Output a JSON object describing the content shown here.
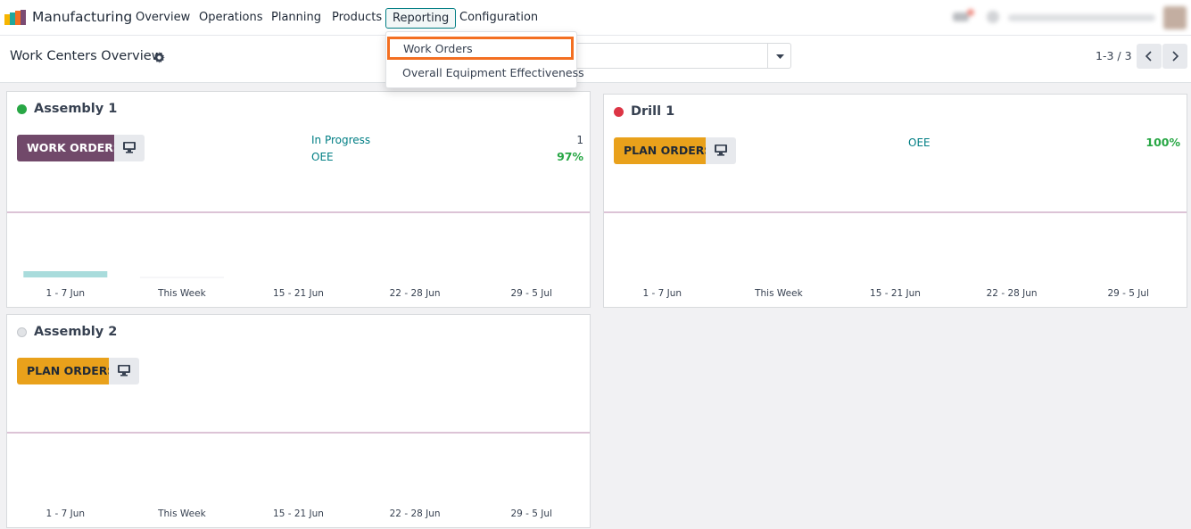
{
  "app": {
    "name": "Manufacturing"
  },
  "menu": {
    "overview": "Overview",
    "operations": "Operations",
    "planning": "Planning",
    "products": "Products",
    "reporting": "Reporting",
    "configuration": "Configuration"
  },
  "reporting_dropdown": {
    "work_orders": "Work Orders",
    "oee": "Overall Equipment Effectiveness"
  },
  "control_panel": {
    "title": "Work Centers Overview",
    "pager": "1-3 / 3"
  },
  "week_labels": [
    "1 - 7 Jun",
    "This Week",
    "15 - 21 Jun",
    "22 - 28 Jun",
    "29 - 5 Jul"
  ],
  "work_centers": [
    {
      "name": "Assembly 1",
      "status_color": "#28a745",
      "action_label": "WORK ORDERS",
      "stats": [
        {
          "label": "In Progress",
          "value": "1"
        },
        {
          "label": "OEE",
          "value": "97%"
        }
      ],
      "chart_data": {
        "type": "bar",
        "categories": [
          "1 - 7 Jun",
          "This Week",
          "15 - 21 Jun",
          "22 - 28 Jun",
          "29 - 5 Jul"
        ],
        "values": [
          1,
          0,
          0,
          0,
          0
        ]
      }
    },
    {
      "name": "Drill 1",
      "status_color": "#dc3545",
      "action_label": "PLAN ORDERS",
      "stats": [
        {
          "label": "OEE",
          "value": "100%"
        }
      ],
      "chart_data": {
        "type": "bar",
        "categories": [
          "1 - 7 Jun",
          "This Week",
          "15 - 21 Jun",
          "22 - 28 Jun",
          "29 - 5 Jul"
        ],
        "values": [
          0,
          0,
          0,
          0,
          0
        ]
      }
    },
    {
      "name": "Assembly 2",
      "status_color": "#e1e3e6",
      "action_label": "PLAN ORDERS",
      "stats": [],
      "chart_data": {
        "type": "bar",
        "categories": [
          "1 - 7 Jun",
          "This Week",
          "15 - 21 Jun",
          "22 - 28 Jun",
          "29 - 5 Jul"
        ],
        "values": [
          0,
          0,
          0,
          0,
          0
        ]
      }
    }
  ],
  "colors": {
    "accent": "#017e84",
    "work_orders_button": "#71496a",
    "plan_orders_button": "#e9a11b",
    "highlight": "#f36f21",
    "bar": "#a9dcdc"
  }
}
